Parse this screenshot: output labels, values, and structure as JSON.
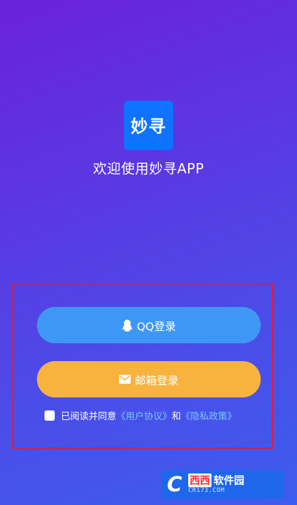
{
  "app": {
    "logo_text": "妙寻",
    "welcome": "欢迎使用妙寻APP"
  },
  "login": {
    "qq_label": "QQ登录",
    "email_label": "邮箱登录"
  },
  "agreement": {
    "prefix": "已阅读并同意",
    "user_agreement": "《用户协议》",
    "and": "和",
    "privacy_policy": "《隐私政策》",
    "checked": false
  },
  "watermark": {
    "logo_letter": "C",
    "main_red": "西西",
    "main": "软件园",
    "sub": "CR173.COM"
  },
  "colors": {
    "qq_button": "#3f97f5",
    "email_button": "#f8b33f",
    "logo_bg": "#0f73ff",
    "highlight_border": "#e21b3a",
    "link": "#7cc6ff"
  }
}
